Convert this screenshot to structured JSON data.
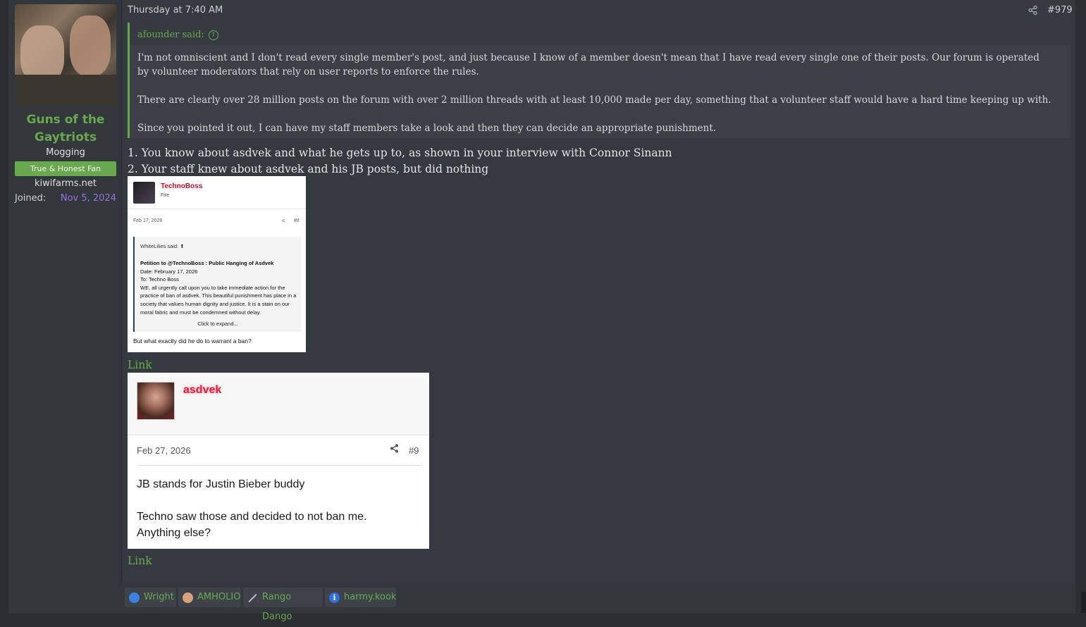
{
  "post": {
    "date": "Thursday at 7:40 AM",
    "number": "#979",
    "share_icon": "share-icon"
  },
  "author": {
    "name": "Guns of the Gaytriots",
    "title": "Mogging",
    "banner": "True & Honest Fan",
    "extra": "kiwifarms.net",
    "joined_label": "Joined:",
    "joined_value": "Nov 5, 2024"
  },
  "quote": {
    "author": "afounder said:",
    "paragraphs": [
      "I'm not omniscient and I don't read every single member's post, and just because I know of a member doesn't mean that I have read every single one of their posts. Our forum is operated by volunteer moderators that rely on user reports to enforce the rules.",
      "There are clearly over 28 million posts on the forum with over 2 million threads with at least 10,000 made per day, something that a volunteer staff would have a hard time keeping up with.",
      "Since you pointed it out, I can have my staff members take a look and then they can decide an appropriate punishment."
    ]
  },
  "body": {
    "line1": "1. You know about asdvek and what he gets up to, as shown in your interview with Connor Sinann",
    "line2": "2. Your staff knew about asdvek and his JB posts, but did nothing",
    "link1": "Link",
    "link2": "Link"
  },
  "image1": {
    "user": "TechnoBoss",
    "user_title": "Fire",
    "date": "Feb 17, 2026",
    "number": "#8",
    "quote_author": "WhiteLilies said:",
    "quote_title": "Petition to @TechnoBoss : Public Hanging of Asdvek",
    "quote_lines": [
      "Date: February 17, 2026",
      "To: Techno Boss",
      "WE, all urgently call upon you to take immediate action for the practice of ban of asdvek. This beautiful punishment has place in a society that values human dignity and justice. It is a stain on our moral fabric and must be condemned without delay."
    ],
    "expand": "Click to expand...",
    "reply": "But what exactly did he do to warrant a ban?"
  },
  "image2": {
    "user": "asdvek",
    "date": "Feb 27, 2026",
    "number": "#9",
    "line1": "JB stands for Justin Bieber buddy",
    "line2": "Techno saw those and decided to not ban me.",
    "line3": "Anything else?"
  },
  "reactions": [
    {
      "name": "Wright",
      "icon": "thumbs-up-icon"
    },
    {
      "name": "AMHOLIO",
      "icon": "face-icon"
    },
    {
      "name": "Rango Dango",
      "icon": "brush-icon"
    },
    {
      "name": "harmy.kook",
      "icon": "info-icon"
    }
  ],
  "colors": {
    "accent_green": "#6aa84f",
    "joined_purple": "#9b6fe0",
    "background": "#353a40",
    "asdvek_red": "#e02046",
    "technoboss_red": "#b8132b"
  }
}
